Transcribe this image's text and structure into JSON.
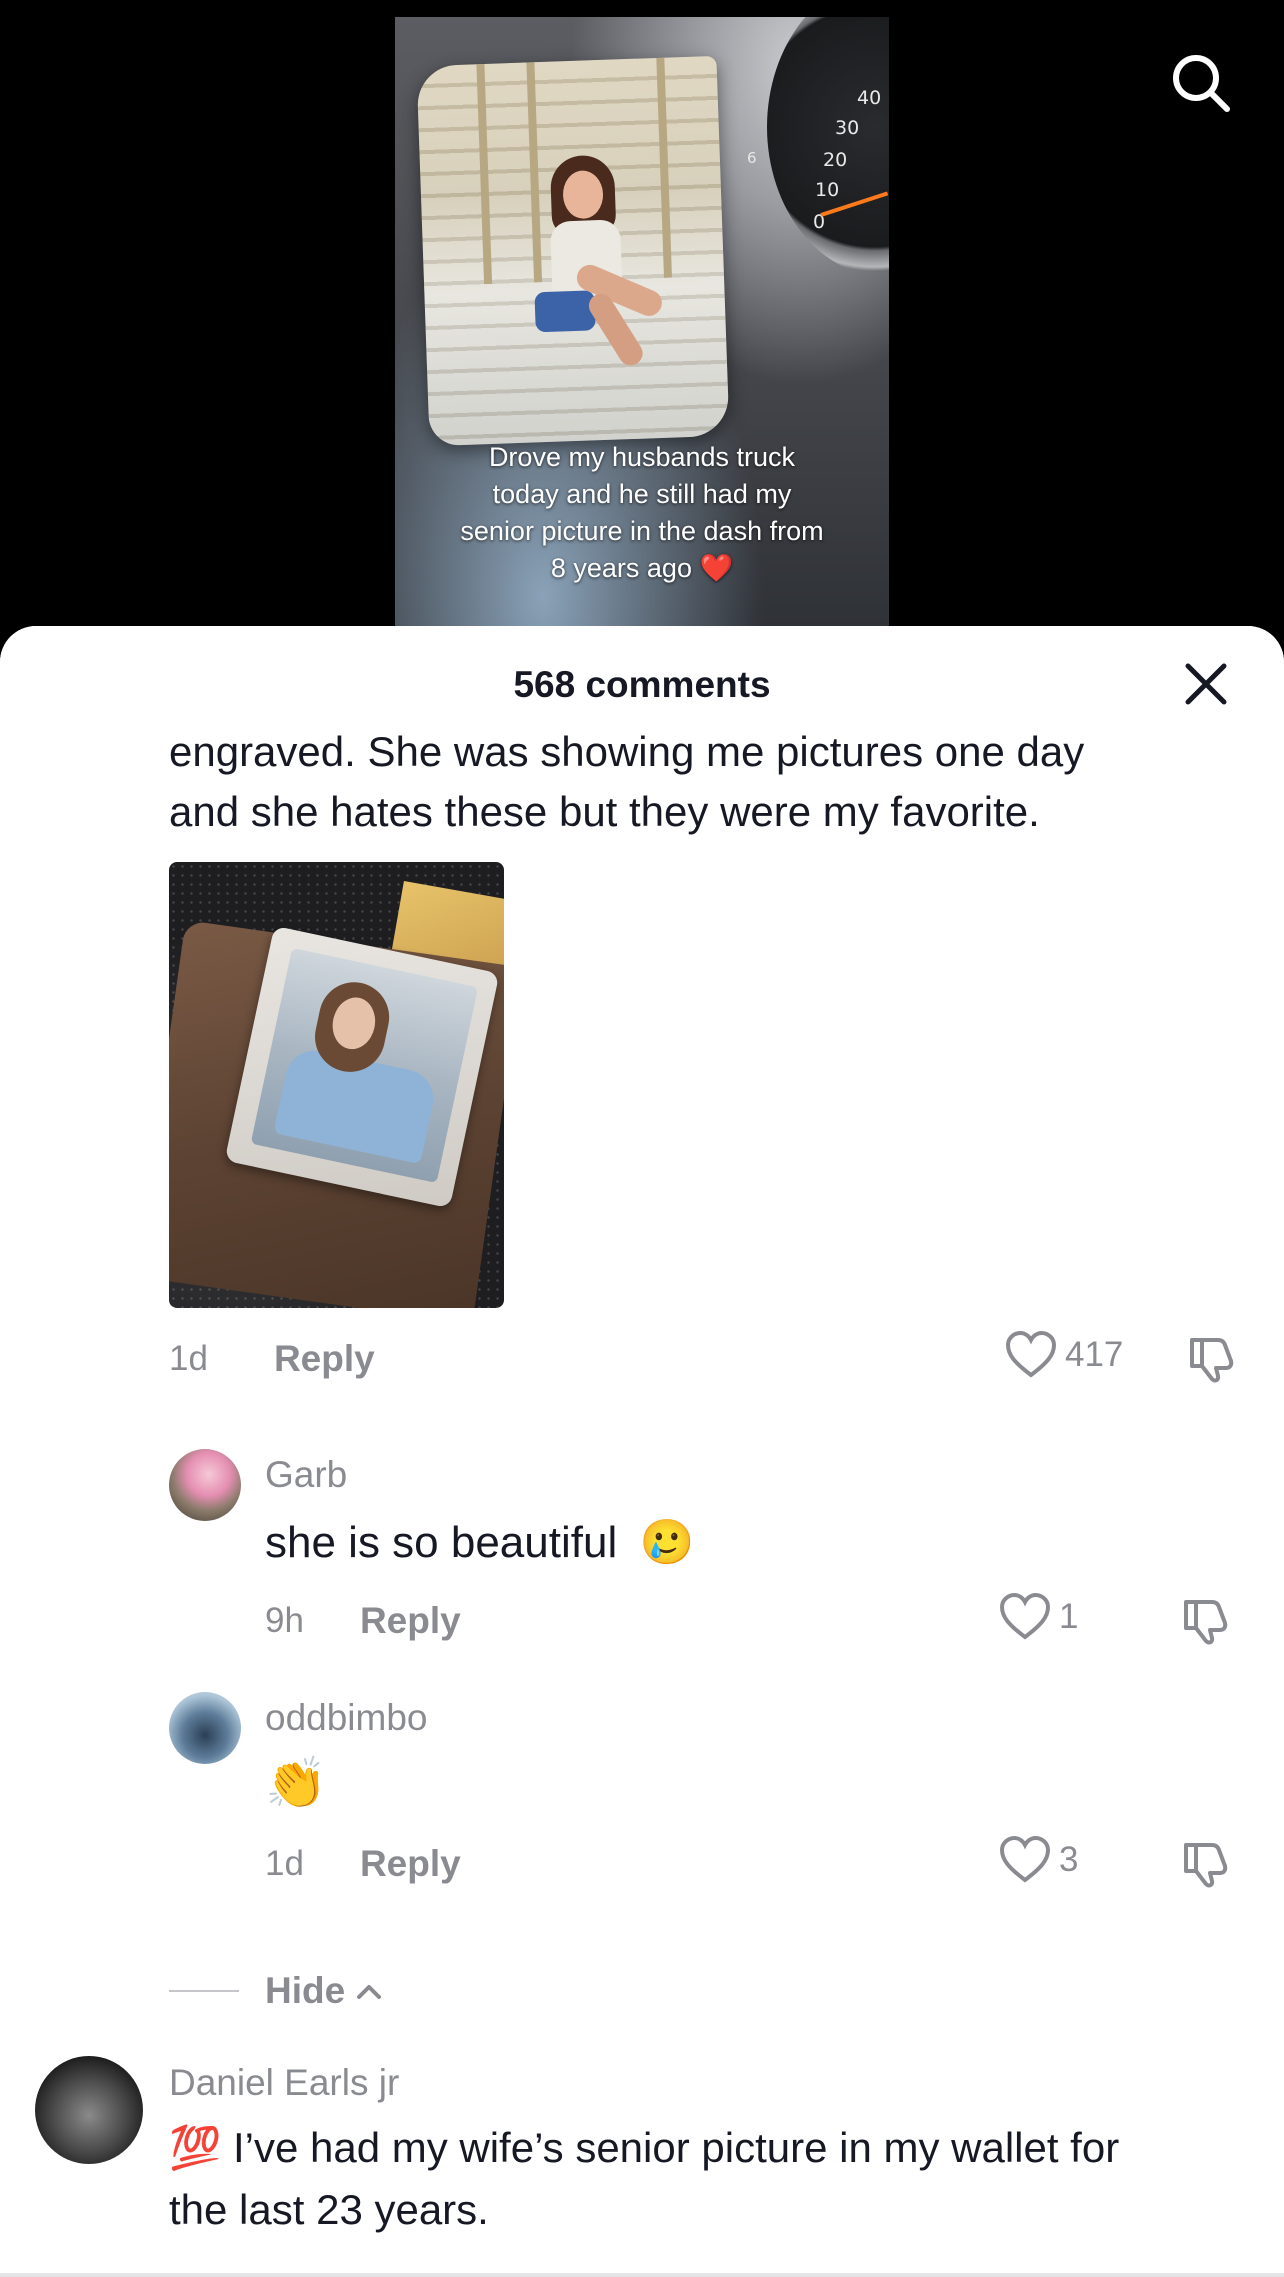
{
  "video": {
    "caption_lines": [
      "Drove my husbands truck",
      "today and he still had my",
      "senior picture in the dash from",
      "8 years ago"
    ],
    "caption_emoji": "❤️",
    "gauge_numbers": [
      "40",
      "30",
      "20",
      "10",
      "0",
      "6"
    ]
  },
  "sheet": {
    "comments_count": "568 comments"
  },
  "top_comment": {
    "partial_text_line1": "engraved. She was showing me pictures one day",
    "partial_text_line2": "and she hates these but they were my favorite.",
    "time": "1d",
    "reply_label": "Reply",
    "likes": "417"
  },
  "replies": [
    {
      "username": "Garb",
      "text": "she is so beautiful",
      "emoji": "🥲",
      "time": "9h",
      "reply_label": "Reply",
      "likes": "1"
    },
    {
      "username": "oddbimbo",
      "text": "",
      "emoji": "👏",
      "time": "1d",
      "reply_label": "Reply",
      "likes": "3"
    }
  ],
  "hide_label": "Hide",
  "next_comment": {
    "username": "Daniel Earls jr",
    "emoji": "💯",
    "text_line1": "I’ve had my wife’s senior picture in my wallet for",
    "text_line2": "the last 23 years."
  },
  "colors": {
    "text_primary": "#161823",
    "text_secondary": "#8a8b91",
    "heart_red": "#e8222c"
  },
  "icons": [
    "search-icon",
    "close-icon",
    "heart-outline-icon",
    "dislike-icon",
    "chevron-up-icon"
  ]
}
